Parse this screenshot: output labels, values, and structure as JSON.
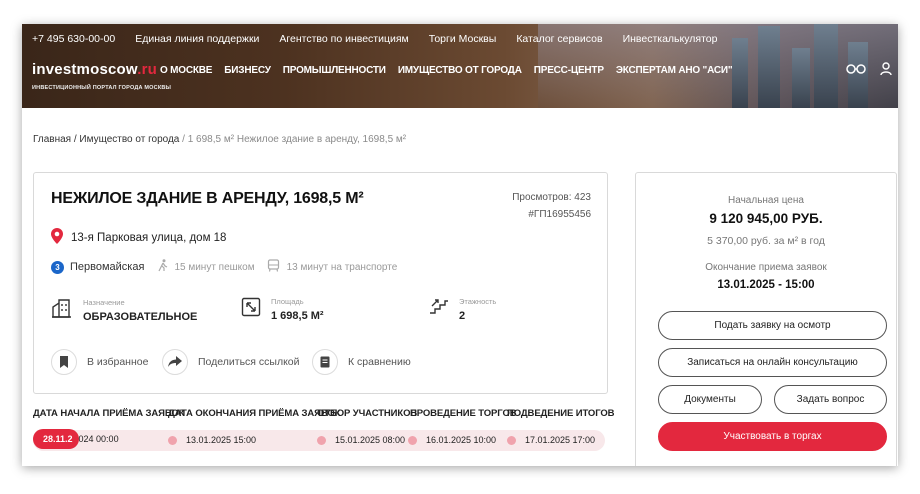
{
  "header": {
    "topbar": [
      "+7 495 630-00-00",
      "Единая линия поддержки",
      "Агентство по инвестициям",
      "Торги Москвы",
      "Каталог сервисов",
      "Инвесткалькулятор"
    ],
    "logo_main": "investmoscow",
    "logo_domain": ".ru",
    "logo_sub": "ИНВЕСТИЦИОННЫЙ ПОРТАЛ ГОРОДА МОСКВЫ",
    "nav": [
      "О МОСКВЕ",
      "БИЗНЕСУ",
      "ПРОМЫШЛЕННОСТИ",
      "ИМУЩЕСТВО ОТ ГОРОДА",
      "ПРЕСС-ЦЕНТР",
      "ЭКСПЕРТАМ АНО \"АСИ\""
    ]
  },
  "breadcrumb": {
    "home": "Главная",
    "section": "Имущество от города",
    "current": "1 698,5 м² Нежилое здание в аренду, 1698,5 м²",
    "sep": " / "
  },
  "object": {
    "title": "НЕЖИЛОЕ ЗДАНИЕ В АРЕНДУ, 1698,5 М²",
    "views": "Просмотров: 423",
    "code": "#ГП16955456",
    "address": "13-я Парковая улица, дом 18",
    "metro": {
      "line_number": "3",
      "line_color": "#1b66c9",
      "station": "Первомайская",
      "walk": "15 минут пешком",
      "transport": "13 минут на транспорте"
    },
    "props": [
      {
        "label": "Назначение",
        "value": "ОБРАЗОВАТЕЛЬНОЕ",
        "icon": "building-icon"
      },
      {
        "label": "Площадь",
        "value": "1 698,5 М²",
        "icon": "area-icon"
      },
      {
        "label": "Этажность",
        "value": "2",
        "icon": "stairs-icon"
      }
    ],
    "actions": [
      {
        "label": "В избранное",
        "icon": "bookmark-icon"
      },
      {
        "label": "Поделиться ссылкой",
        "icon": "share-icon"
      },
      {
        "label": "К сравнению",
        "icon": "compare-icon"
      }
    ]
  },
  "timeline": {
    "headers": [
      "ДАТА НАЧАЛА ПРИЁМА ЗАЯВОК",
      "ДАТА ОКОНЧАНИЯ ПРИЁМА ЗАЯВОК",
      "ОТБОР УЧАСТНИКОВ",
      "ПРОВЕДЕНИЕ ТОРГОВ",
      "ПОДВЕДЕНИЕ ИТОГОВ"
    ],
    "start_highlight": "28.11.2",
    "start_rest": "024 00:00",
    "values": [
      "13.01.2025 15:00",
      "15.01.2025 08:00",
      "16.01.2025 10:00",
      "17.01.2025 17:00"
    ]
  },
  "side": {
    "price_label": "Начальная цена",
    "price": "9 120 945,00 РУБ.",
    "price_per_sq": "5 370,00 руб. за м² в год",
    "end_label": "Окончание приема заявок",
    "end_value": "13.01.2025 - 15:00",
    "btn_inspect": "Подать заявку на осмотр",
    "btn_consult": "Записаться на онлайн консультацию",
    "btn_docs": "Документы",
    "btn_question": "Задать вопрос",
    "btn_participate": "Участвовать в торгах"
  },
  "colors": {
    "accent": "#e3283e",
    "metro_line": "#1b66c9"
  }
}
